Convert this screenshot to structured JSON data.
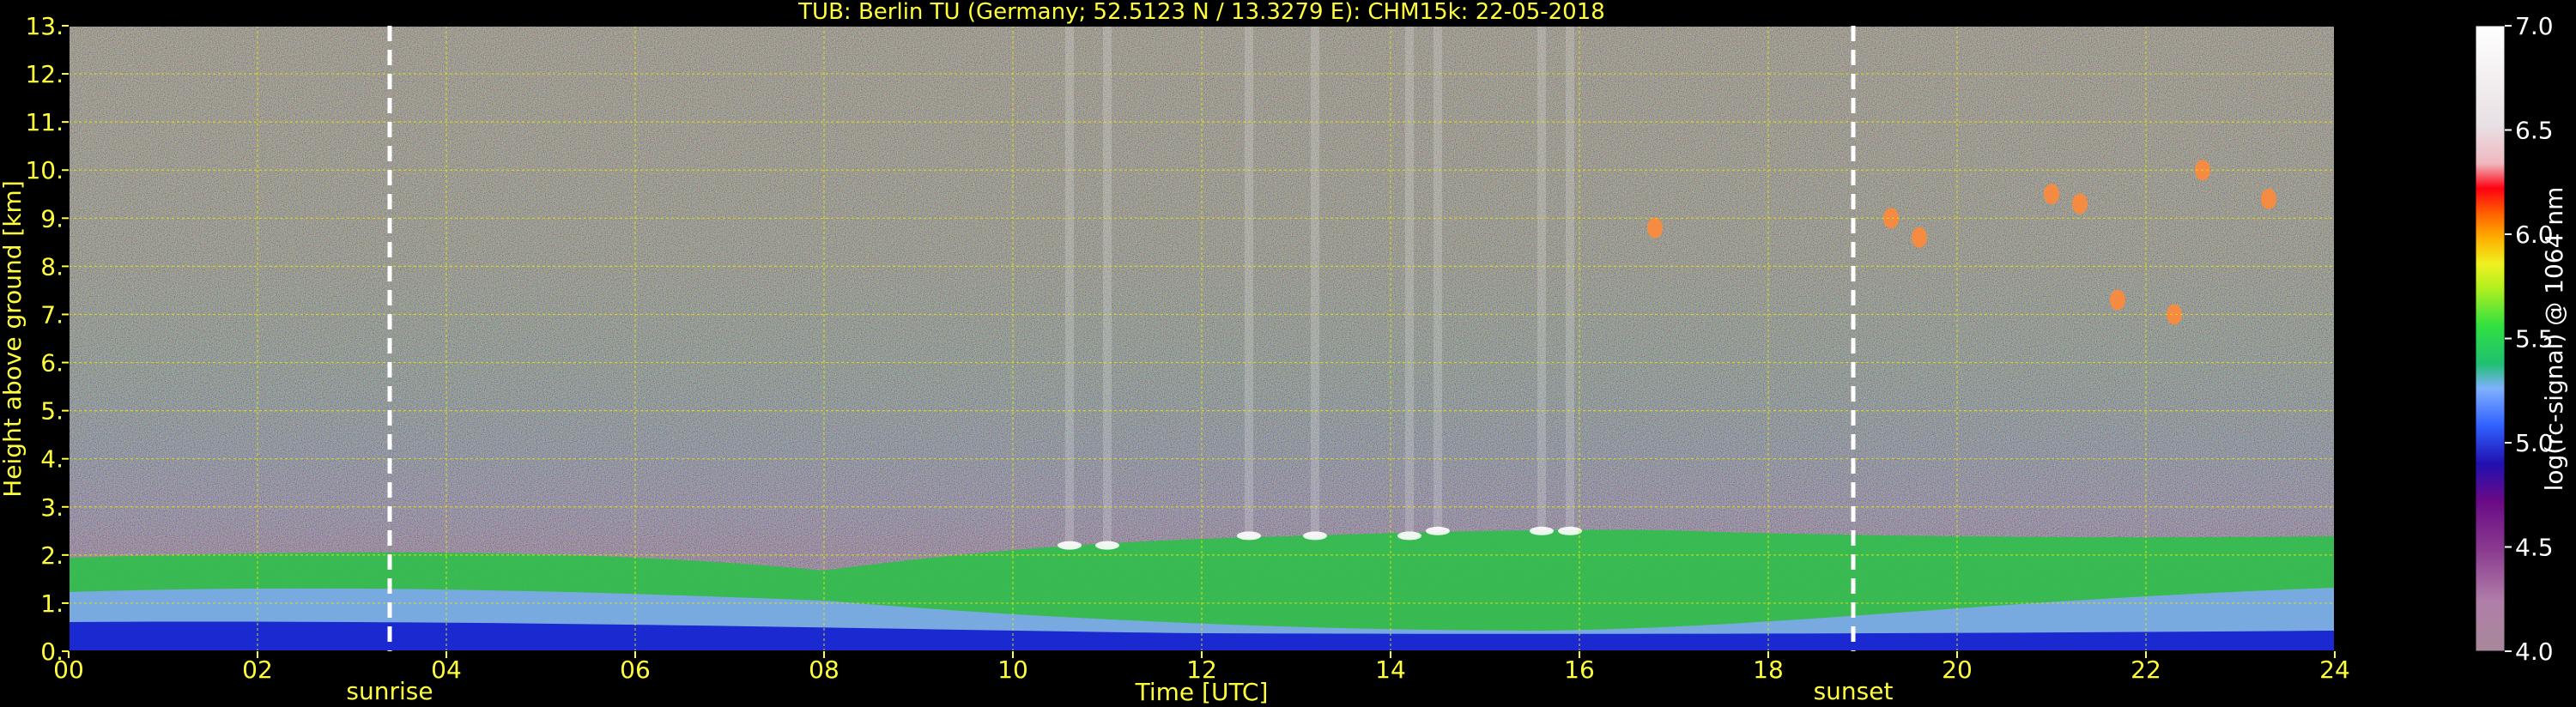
{
  "chart_data": {
    "type": "heatmap",
    "title": "TUB: Berlin TU (Germany; 52.5123 N / 13.3279 E):    CHM15k: 22-05-2018",
    "xlabel": "Time [UTC]",
    "ylabel": "Height above ground [km]",
    "xlim": [
      0,
      24
    ],
    "ylim": [
      0,
      13
    ],
    "x_tick_labels": [
      "00",
      "02",
      "04",
      "06",
      "08",
      "10",
      "12",
      "14",
      "16",
      "18",
      "20",
      "22",
      "24"
    ],
    "y_tick_labels": [
      "0.",
      "1.",
      "2.",
      "3.",
      "4.",
      "5.",
      "6.",
      "7.",
      "8.",
      "9.",
      "10.",
      "11.",
      "12.",
      "13."
    ],
    "grid": true,
    "colorbar": {
      "label": "log(rc-signal) @ 1064 nm",
      "range": [
        4.0,
        7.0
      ],
      "tick_labels": [
        "4.0",
        "4.5",
        "5.0",
        "5.5",
        "6.0",
        "6.5",
        "7.0"
      ]
    },
    "annotations": [
      {
        "label": "sunrise",
        "x": 3.4
      },
      {
        "label": "sunset",
        "x": 18.9
      }
    ],
    "cloud_events": [
      {
        "x": 10.6,
        "y": 2.2
      },
      {
        "x": 11.0,
        "y": 2.2
      },
      {
        "x": 12.5,
        "y": 2.4
      },
      {
        "x": 13.2,
        "y": 2.4
      },
      {
        "x": 14.2,
        "y": 2.4
      },
      {
        "x": 14.5,
        "y": 2.5
      },
      {
        "x": 15.6,
        "y": 2.5
      },
      {
        "x": 15.9,
        "y": 2.5
      },
      {
        "x": 16.8,
        "y": 8.8
      },
      {
        "x": 19.3,
        "y": 9.0
      },
      {
        "x": 19.6,
        "y": 8.6
      },
      {
        "x": 21.0,
        "y": 9.5
      },
      {
        "x": 21.3,
        "y": 9.3
      },
      {
        "x": 21.7,
        "y": 7.3
      },
      {
        "x": 22.3,
        "y": 7.0
      },
      {
        "x": 22.6,
        "y": 10.0
      },
      {
        "x": 23.3,
        "y": 9.4
      }
    ]
  }
}
